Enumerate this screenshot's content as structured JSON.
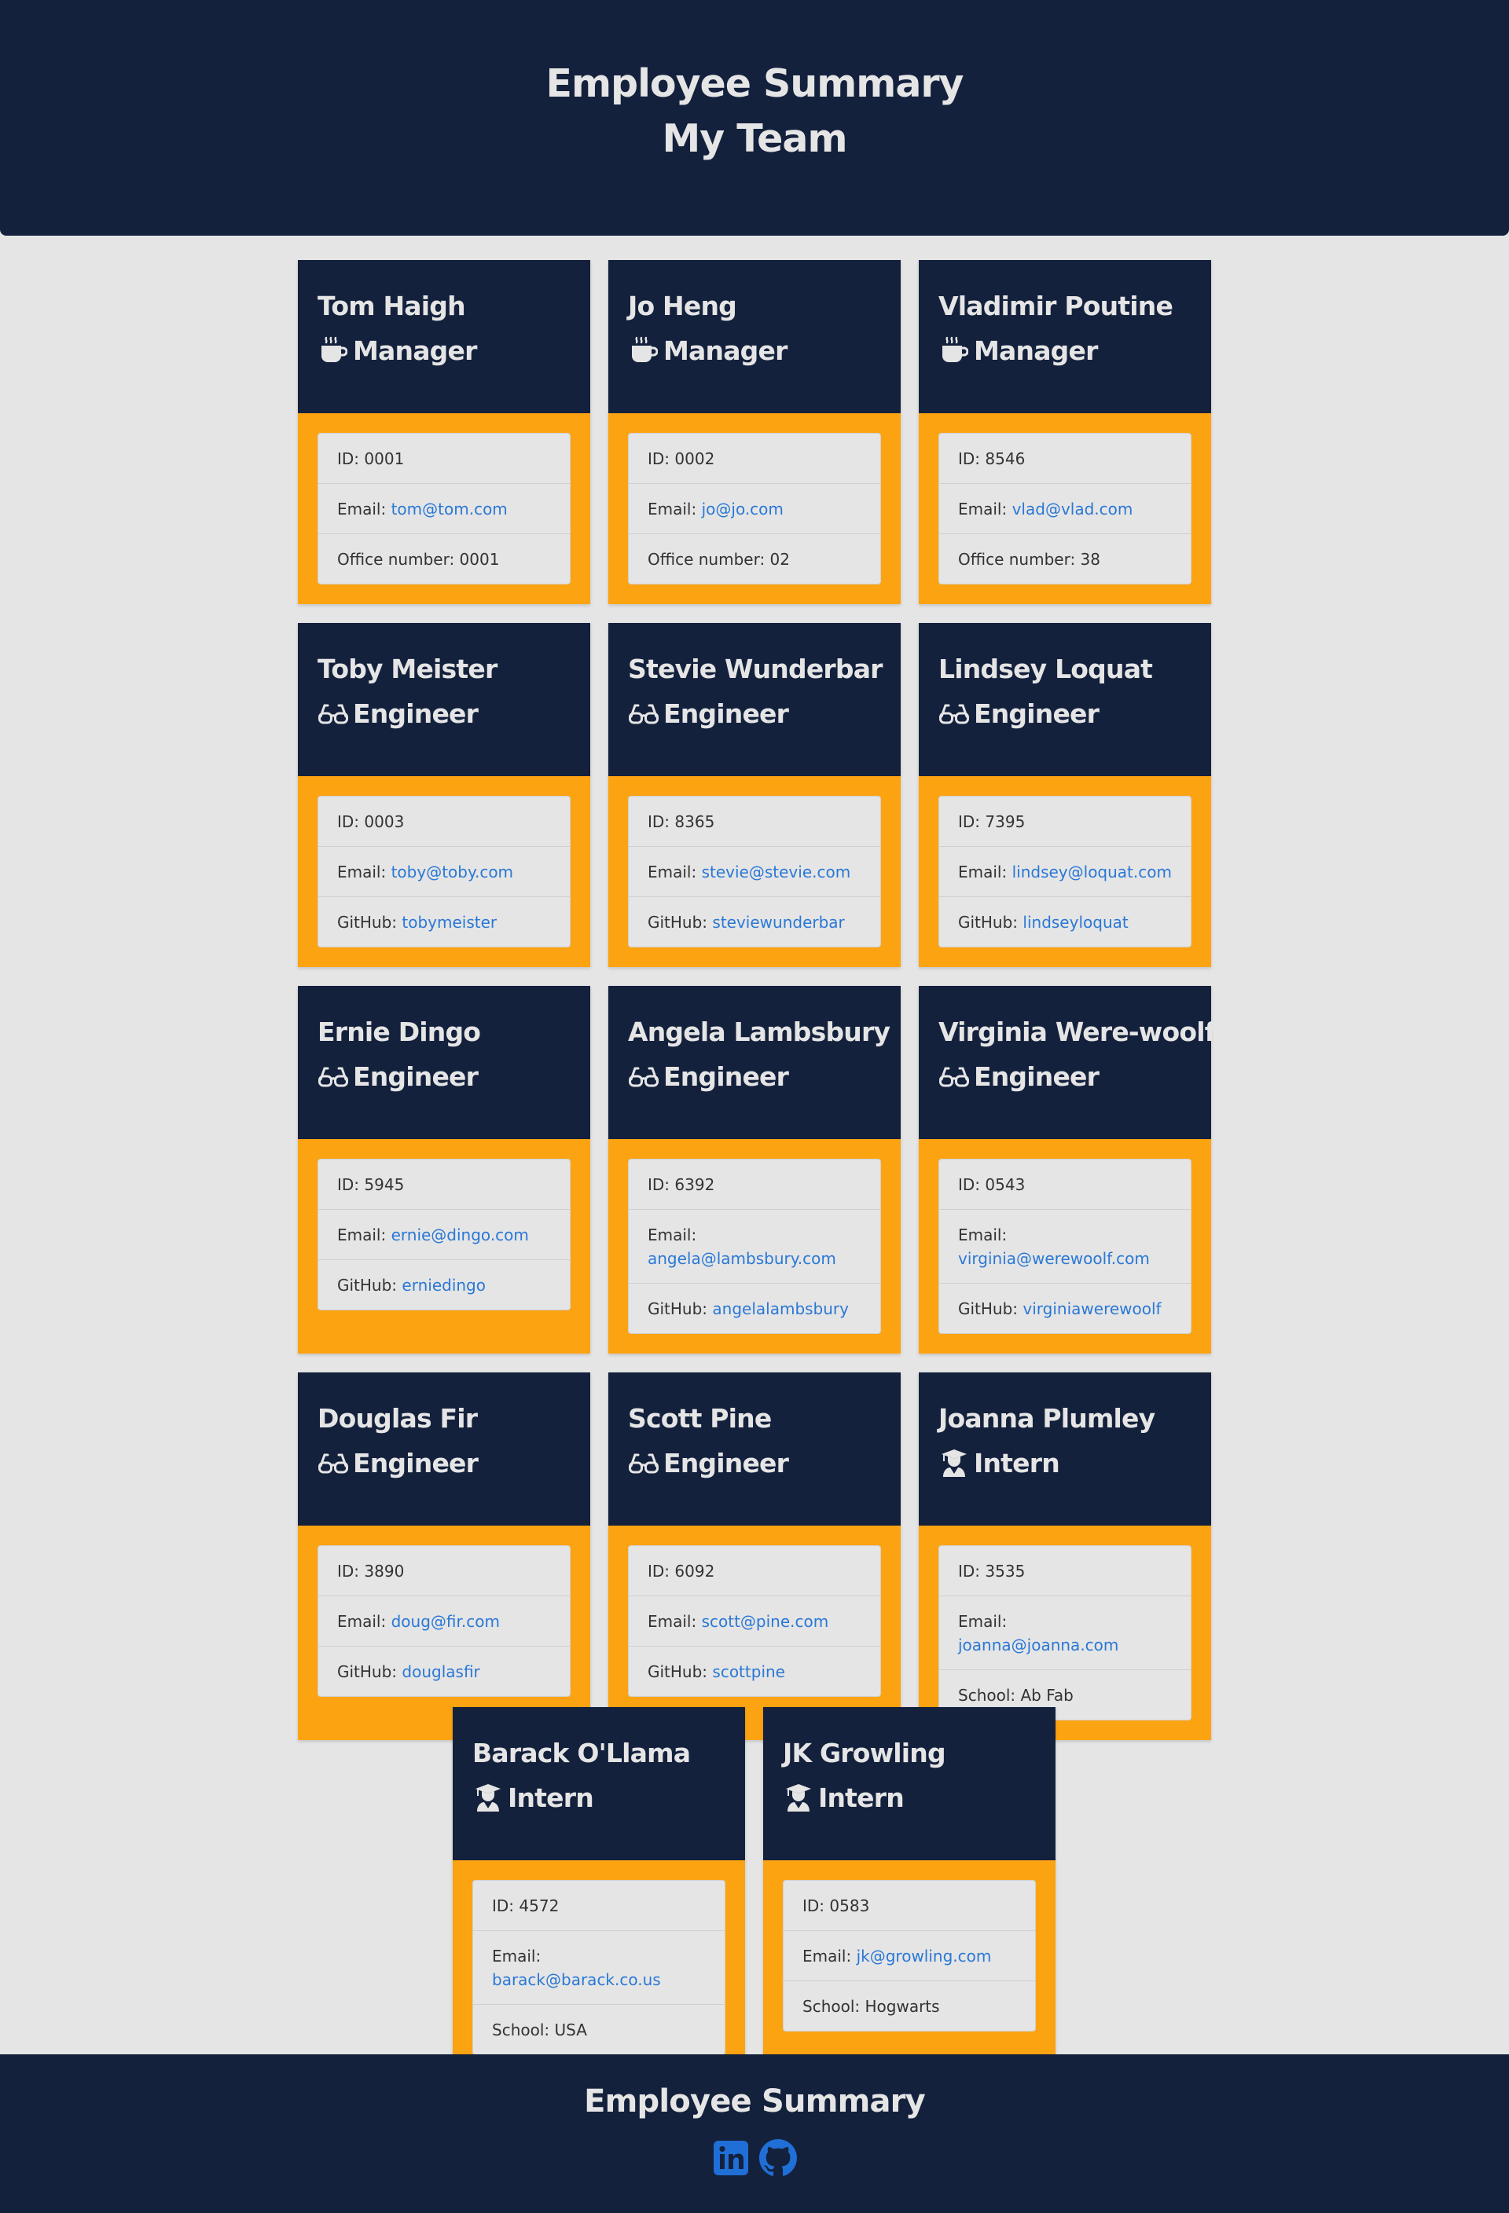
{
  "header": {
    "title": "Employee Summary",
    "subtitle": "My Team"
  },
  "labels": {
    "id": "ID: ",
    "email": "Email: ",
    "office": "Office number: ",
    "github": "GitHub: ",
    "school": "School: "
  },
  "role_icons": {
    "Manager": "coffee-mug-icon",
    "Engineer": "glasses-icon",
    "Intern": "graduate-icon"
  },
  "employees": [
    {
      "name": "Tom Haigh",
      "role": "Manager",
      "id": "0001",
      "email": "tom@tom.com",
      "extra_type": "office",
      "extra": "0001"
    },
    {
      "name": "Jo Heng",
      "role": "Manager",
      "id": "0002",
      "email": "jo@jo.com",
      "extra_type": "office",
      "extra": "02"
    },
    {
      "name": "Vladimir Poutine",
      "role": "Manager",
      "id": "8546",
      "email": "vlad@vlad.com",
      "extra_type": "office",
      "extra": "38"
    },
    {
      "name": "Toby Meister",
      "role": "Engineer",
      "id": "0003",
      "email": "toby@toby.com",
      "extra_type": "github",
      "extra": "tobymeister"
    },
    {
      "name": "Stevie Wunderbar",
      "role": "Engineer",
      "id": "8365",
      "email": "stevie@stevie.com",
      "extra_type": "github",
      "extra": "steviewunderbar"
    },
    {
      "name": "Lindsey Loquat",
      "role": "Engineer",
      "id": "7395",
      "email": "lindsey@loquat.com",
      "extra_type": "github",
      "extra": "lindseyloquat"
    },
    {
      "name": "Ernie Dingo",
      "role": "Engineer",
      "id": "5945",
      "email": "ernie@dingo.com",
      "extra_type": "github",
      "extra": "erniedingo"
    },
    {
      "name": "Angela Lambsbury",
      "role": "Engineer",
      "id": "6392",
      "email": "angela@lambsbury.com",
      "extra_type": "github",
      "extra": "angelalambsbury"
    },
    {
      "name": "Virginia Were-woolf",
      "role": "Engineer",
      "id": "0543",
      "email": "virginia@werewoolf.com",
      "extra_type": "github",
      "extra": "virginiawerewoolf"
    },
    {
      "name": "Douglas Fir",
      "role": "Engineer",
      "id": "3890",
      "email": "doug@fir.com",
      "extra_type": "github",
      "extra": "douglasfir"
    },
    {
      "name": "Scott Pine",
      "role": "Engineer",
      "id": "6092",
      "email": "scott@pine.com",
      "extra_type": "github",
      "extra": "scottpine"
    },
    {
      "name": "Joanna Plumley",
      "role": "Intern",
      "id": "3535",
      "email": "joanna@joanna.com",
      "extra_type": "school",
      "extra": "Ab Fab"
    },
    {
      "name": "Barack O'Llama",
      "role": "Intern",
      "id": "4572",
      "email": "barack@barack.co.us",
      "extra_type": "school",
      "extra": "USA"
    },
    {
      "name": "JK Growling",
      "role": "Intern",
      "id": "0583",
      "email": "jk@growling.com",
      "extra_type": "school",
      "extra": "Hogwarts"
    }
  ],
  "footer": {
    "title": "Employee Summary",
    "links": [
      {
        "icon": "linkedin-icon"
      },
      {
        "icon": "github-icon"
      }
    ]
  },
  "colors": {
    "navy": "#14213d",
    "orange": "#fca311",
    "light_gray": "#e5e5e5",
    "link_blue": "#2a78d6"
  }
}
